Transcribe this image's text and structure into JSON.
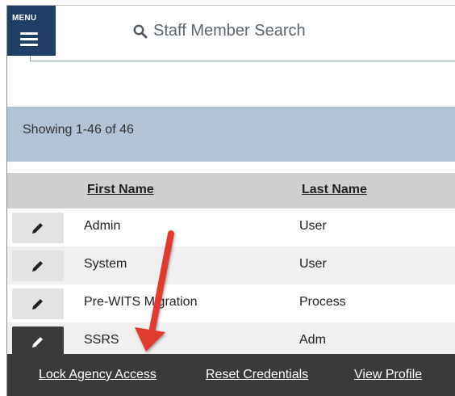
{
  "header": {
    "menu_label": "MENU",
    "search_placeholder": "Staff Member Search"
  },
  "results": {
    "summary": "Showing 1-46 of 46"
  },
  "table": {
    "columns": [
      "First Name",
      "Last Name"
    ],
    "rows": [
      {
        "first": "Admin",
        "last": "User"
      },
      {
        "first": "System",
        "last": "User"
      },
      {
        "first": "Pre-WITS Migration",
        "last": "Process"
      },
      {
        "first": "SSRS",
        "last": "Adm"
      }
    ]
  },
  "row_actions": {
    "lock": "Lock Agency Access",
    "reset": "Reset Credentials",
    "view": "View Profile"
  },
  "colors": {
    "menu_bg": "#1f3f66",
    "results_bar": "#b3c3d6",
    "header_row": "#cfcfcf",
    "action_bar": "#3a3a3a",
    "annotation_arrow": "#e03a2f"
  },
  "icons": [
    "menu-icon",
    "search-icon",
    "pencil-icon",
    "annotation-arrow"
  ]
}
